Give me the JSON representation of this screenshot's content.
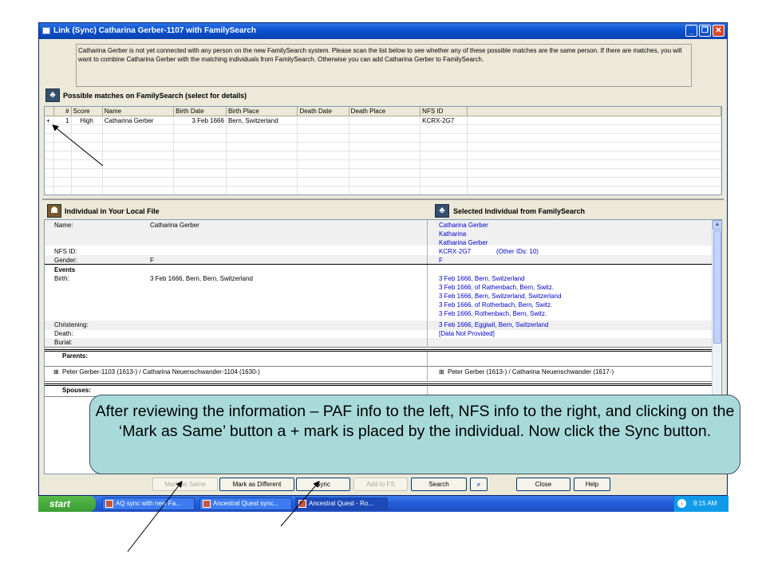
{
  "window": {
    "title": "Link (Sync) Catharina Gerber-1107 with FamilySearch",
    "controls": {
      "minimize": "_",
      "restore": "❐",
      "close": "✕"
    }
  },
  "intro_text": "Catharina Gerber is not yet connected with any person on the new FamilySearch system. Please scan the list below to see whether any of these possible matches are the same person. If there are matches, you will want to combine Catharina Gerber with the matching individuals from FamilySearch. Otherwise you can add Catharina Gerber to FamilySearch.",
  "matches": {
    "header": "Possible matches on FamilySearch (select for details)",
    "columns": [
      "#",
      "Score",
      "Name",
      "Birth Date",
      "Birth Place",
      "Death Date",
      "Death Place",
      "NFS ID"
    ],
    "rows": [
      {
        "mark": "+",
        "num": "1",
        "score": "High",
        "name": "Catharina Gerber",
        "birth_date": "3 Feb 1666",
        "birth_place": "Bern, Switzerland",
        "death_date": "",
        "death_place": "",
        "nfs_id": "KCRX-2G7"
      }
    ]
  },
  "local": {
    "header": "Individual in Your Local File",
    "name_label": "Name:",
    "name": "Catharina Gerber",
    "nfs_id_label": "NFS ID:",
    "gender_label": "Gender:",
    "gender": "F",
    "events_label": "Events",
    "birth_label": "Birth:",
    "birth": "3 Feb 1666, Bern, Bern, Switzerland",
    "christening_label": "Christening:",
    "death_label": "Death:",
    "burial_label": "Burial:",
    "parents_label": "Parents:",
    "parents": "Peter Gerber-1103 (1613-) / Catharina Neuenschwander-1104 (1630-)",
    "spouses_label": "Spouses:"
  },
  "familysearch": {
    "header": "Selected Individual from FamilySearch",
    "names": [
      "Catharina Gerber",
      "Katharina",
      "Katharina Gerber"
    ],
    "nfs_id": "KCRX-2G7",
    "other_ids": "(Other IDs: 10)",
    "gender": "F",
    "births": [
      "3 Feb 1666, Bern, Switzerland",
      "3 Feb 1666, of Rathenbach, Bern, Switz.",
      "3 Feb 1666, Bern, Switzerland, Switzerland",
      "3 Feb 1666, of Rotherbach, Bern, Switz.",
      "3 Feb 1666, Rothenbach, Bern, Switz."
    ],
    "christening": "3 Feb 1666, Eggiwil, Bern, Switzerland",
    "death": "[Data Not Provided]",
    "parents": "Peter Gerber (1613-) / Catharina Neuenschwander (1617-)"
  },
  "buttons": {
    "mark_same": "Mark as Same",
    "mark_different": "Mark as Different",
    "sync": "Sync",
    "add_to_fs": "Add to FS",
    "search": "Search",
    "close": "Close",
    "help": "Help"
  },
  "taskbar": {
    "start": "start",
    "tasks": [
      "AQ sync with new Fa...",
      "Ancestral Quest sync...",
      "Ancestral Quest - Ro..."
    ],
    "clock": "9:15 AM"
  },
  "callout": "After reviewing the information – PAF info to the left, NFS info to the right, and clicking on the ‘Mark as Same’ button a + mark is placed by the individual.  Now click the Sync button."
}
